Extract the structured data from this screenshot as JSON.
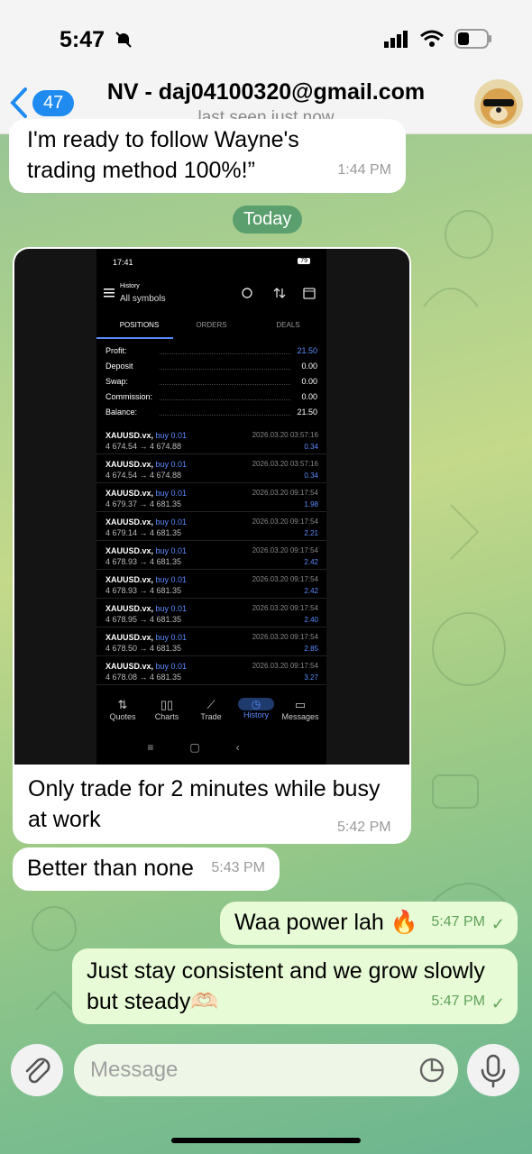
{
  "status_bar": {
    "time": "5:47"
  },
  "header": {
    "back_count": "47",
    "title": "NV - daj04100320@gmail.com",
    "subtitle": "last seen just now"
  },
  "messages": [
    {
      "text": "I'm ready to follow Wayne's trading method 100%!”",
      "time": "1:44 PM"
    },
    {
      "text": "Only trade for 2 minutes while busy at work",
      "time": "5:42 PM"
    },
    {
      "text": "Better than none",
      "time": "5:43 PM"
    },
    {
      "text": "Waa power lah 🔥",
      "time": "5:47 PM"
    },
    {
      "text": "Just stay consistent and we grow slowly but steady🫶🏻",
      "time": "5:47 PM"
    }
  ],
  "date_divider": "Today",
  "screenshot": {
    "status_time": "17:41",
    "battery": "79",
    "app_title": "History",
    "app_subtitle": "All symbols",
    "tabs": [
      "POSITIONS",
      "ORDERS",
      "DEALS"
    ],
    "summary": [
      {
        "label": "Profit:",
        "value": "21.50"
      },
      {
        "label": "Deposit",
        "value": "0.00"
      },
      {
        "label": "Swap:",
        "value": "0.00"
      },
      {
        "label": "Commission:",
        "value": "0.00"
      },
      {
        "label": "Balance:",
        "value": "21.50"
      }
    ],
    "positions": [
      {
        "symbol": "XAUUSD.vx,",
        "side": "buy 0.01",
        "prices": "4 674.54 → 4 674.88",
        "date": "2026.03.20 03:57:16",
        "profit": "0.34"
      },
      {
        "symbol": "XAUUSD.vx,",
        "side": "buy 0.01",
        "prices": "4 674.54 → 4 674.88",
        "date": "2026.03.20 03:57:16",
        "profit": "0.34"
      },
      {
        "symbol": "XAUUSD.vx,",
        "side": "buy 0.01",
        "prices": "4 679.37 → 4 681.35",
        "date": "2026.03.20 09:17:54",
        "profit": "1.98"
      },
      {
        "symbol": "XAUUSD.vx,",
        "side": "buy 0.01",
        "prices": "4 679.14 → 4 681.35",
        "date": "2026.03.20 09:17:54",
        "profit": "2.21"
      },
      {
        "symbol": "XAUUSD.vx,",
        "side": "buy 0.01",
        "prices": "4 678.93 → 4 681.35",
        "date": "2026.03.20 09:17:54",
        "profit": "2.42"
      },
      {
        "symbol": "XAUUSD.vx,",
        "side": "buy 0.01",
        "prices": "4 678.93 → 4 681.35",
        "date": "2026.03.20 09:17:54",
        "profit": "2.42"
      },
      {
        "symbol": "XAUUSD.vx,",
        "side": "buy 0.01",
        "prices": "4 678.95 → 4 681.35",
        "date": "2026.03.20 09:17:54",
        "profit": "2.40"
      },
      {
        "symbol": "XAUUSD.vx,",
        "side": "buy 0.01",
        "prices": "4 678.50 → 4 681.35",
        "date": "2026.03.20 09:17:54",
        "profit": "2.85"
      },
      {
        "symbol": "XAUUSD.vx,",
        "side": "buy 0.01",
        "prices": "4 678.08 → 4 681.35",
        "date": "2026.03.20 09:17:54",
        "profit": "3.27"
      }
    ],
    "nav": [
      "Quotes",
      "Charts",
      "Trade",
      "History",
      "Messages"
    ]
  },
  "input": {
    "placeholder": "Message"
  },
  "colors": {
    "accent": "#1f8bf0",
    "outgoing_bubble": "#e7fbd6",
    "divider_pill": "#5a9f6d",
    "profit_blue": "#5b8cff"
  }
}
